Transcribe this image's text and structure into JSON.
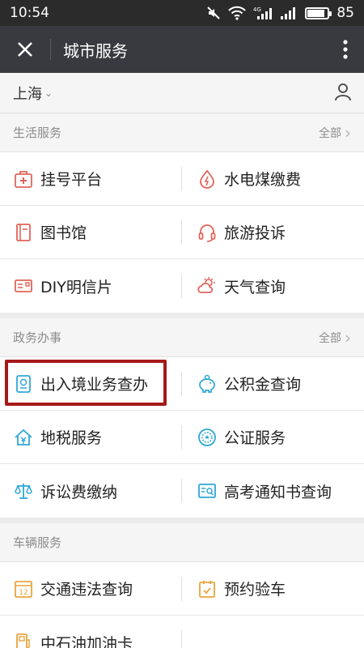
{
  "status_bar": {
    "time": "10:54",
    "battery": "85",
    "battery_level": 0.85,
    "network": "4G"
  },
  "header": {
    "title": "城市服务"
  },
  "city_bar": {
    "city": "上海"
  },
  "sections": [
    {
      "title": "生活服务",
      "all_label": "全部",
      "items": [
        {
          "label": "挂号平台",
          "icon": "medical-kit-icon",
          "color": "#e0645a"
        },
        {
          "label": "水电煤缴费",
          "icon": "water-drop-icon",
          "color": "#e0645a"
        },
        {
          "label": "图书馆",
          "icon": "book-icon",
          "color": "#e0645a"
        },
        {
          "label": "旅游投诉",
          "icon": "headset-icon",
          "color": "#e0645a"
        },
        {
          "label": "DIY明信片",
          "icon": "postcard-icon",
          "color": "#e0645a"
        },
        {
          "label": "天气查询",
          "icon": "weather-icon",
          "color": "#e0645a"
        }
      ]
    },
    {
      "title": "政务办事",
      "all_label": "全部",
      "items": [
        {
          "label": "出入境业务查办",
          "icon": "passport-icon",
          "color": "#2fa8d6"
        },
        {
          "label": "公积金查询",
          "icon": "piggy-bank-icon",
          "color": "#2fa8d6"
        },
        {
          "label": "地税服务",
          "icon": "house-tax-icon",
          "color": "#2fa8d6"
        },
        {
          "label": "公证服务",
          "icon": "seal-icon",
          "color": "#2fa8d6"
        },
        {
          "label": "诉讼费缴纳",
          "icon": "scale-icon",
          "color": "#2fa8d6"
        },
        {
          "label": "高考通知书查询",
          "icon": "id-search-icon",
          "color": "#2fa8d6"
        }
      ]
    },
    {
      "title": "车辆服务",
      "items": [
        {
          "label": "交通违法查询",
          "icon": "calendar-12-icon",
          "calendar_day": "12",
          "color": "#e8a53c"
        },
        {
          "label": "预约验车",
          "icon": "calendar-check-icon",
          "color": "#e8a53c"
        },
        {
          "label": "中石油加油卡",
          "icon": "gas-card-icon",
          "color": "#e8a53c"
        }
      ]
    }
  ],
  "highlight_color": "#a5191a"
}
